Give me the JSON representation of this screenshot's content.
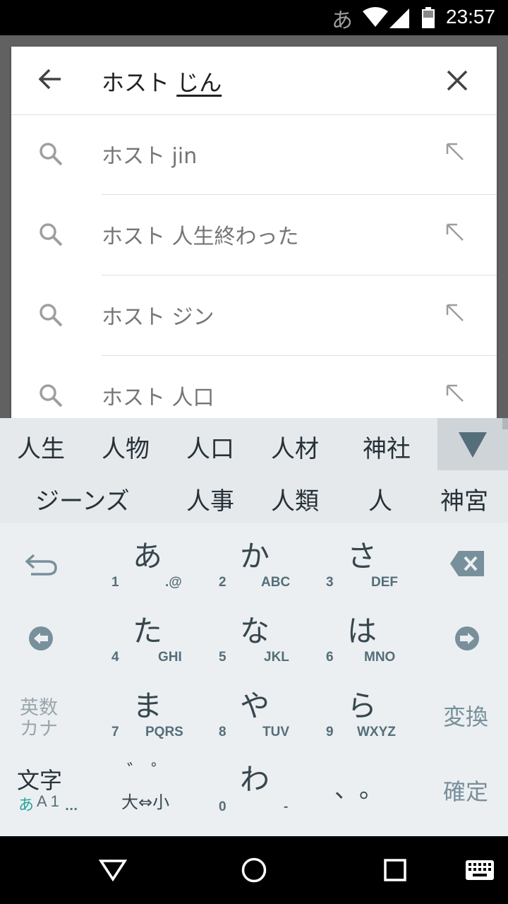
{
  "status_bar": {
    "ime_indicator": "あ",
    "time": "23:57",
    "icons": [
      "wifi-icon",
      "signal-icon",
      "battery-icon"
    ]
  },
  "search": {
    "query_prefix": "ホスト ",
    "query_composing": "じん",
    "back_icon": "arrow-left-icon",
    "clear_icon": "close-icon"
  },
  "suggestions": [
    {
      "text": "ホスト jin"
    },
    {
      "text": "ホスト 人生終わった"
    },
    {
      "text": "ホスト ジン"
    },
    {
      "text": "ホスト 人口"
    }
  ],
  "candidates": {
    "row1": [
      "人生",
      "人物",
      "人口",
      "人材",
      "神社"
    ],
    "row2": [
      "ジーンズ",
      "人事",
      "人類",
      "人",
      "神宮"
    ],
    "toggle_icon": "triangle-down-icon"
  },
  "keyboard": {
    "keys": [
      {
        "kana": "あ",
        "num": "1",
        "alt": ".@"
      },
      {
        "kana": "か",
        "num": "2",
        "alt": "ABC"
      },
      {
        "kana": "さ",
        "num": "3",
        "alt": "DEF"
      },
      {
        "kana": "た",
        "num": "4",
        "alt": "GHI"
      },
      {
        "kana": "な",
        "num": "5",
        "alt": "JKL"
      },
      {
        "kana": "は",
        "num": "6",
        "alt": "MNO"
      },
      {
        "kana": "ま",
        "num": "7",
        "alt": "PQRS"
      },
      {
        "kana": "や",
        "num": "8",
        "alt": "TUV"
      },
      {
        "kana": "ら",
        "num": "9",
        "alt": "WXYZ"
      }
    ],
    "wa_key": {
      "kana": "わ",
      "num": "0",
      "alt": "-"
    },
    "dakuten_key": {
      "top": "゛ ゜",
      "bottom": "大⇔小"
    },
    "punct_key": {
      "label": "、。"
    },
    "eisu_kana": {
      "line1": "英数",
      "line2": "カナ"
    },
    "henkan": "変換",
    "kakutei": "確定",
    "moji": {
      "label": "文字",
      "mode_kana": "あ",
      "mode_latin": "A 1",
      "more": "..."
    }
  },
  "navbar": {
    "icons": [
      "back-triangle-icon",
      "home-circle-icon",
      "recents-square-icon",
      "keyboard-icon"
    ]
  }
}
